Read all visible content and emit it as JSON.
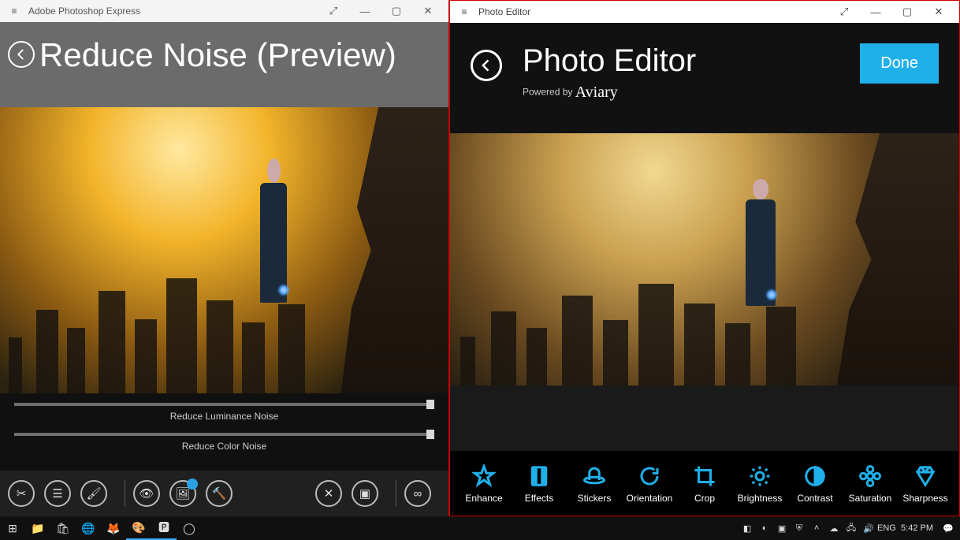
{
  "left": {
    "app_name": "Adobe Photoshop Express",
    "page_title": "Reduce Noise (Preview)",
    "sliders": [
      {
        "label": "Reduce Luminance Noise",
        "value": 100
      },
      {
        "label": "Reduce Color Noise",
        "value": 100
      }
    ],
    "toolbar": {
      "crop": "crop",
      "adjust": "adjust",
      "brush": "brush",
      "view": "view",
      "image": "image",
      "fix": "fix",
      "cancel": "cancel",
      "compare": "compare",
      "share": "share"
    }
  },
  "right": {
    "app_name": "Photo Editor",
    "page_title": "Photo Editor",
    "powered_prefix": "Powered by",
    "powered_brand": "Aviary",
    "done_label": "Done",
    "tools": [
      {
        "id": "enhance",
        "label": "Enhance"
      },
      {
        "id": "effects",
        "label": "Effects"
      },
      {
        "id": "stickers",
        "label": "Stickers"
      },
      {
        "id": "orientation",
        "label": "Orientation"
      },
      {
        "id": "crop",
        "label": "Crop"
      },
      {
        "id": "brightness",
        "label": "Brightness"
      },
      {
        "id": "contrast",
        "label": "Contrast"
      },
      {
        "id": "saturation",
        "label": "Saturation"
      },
      {
        "id": "sharpness",
        "label": "Sharpness"
      }
    ]
  },
  "taskbar": {
    "lang": "ENG",
    "time": "5:42 PM"
  },
  "colors": {
    "accent": "#1fb0ea"
  }
}
